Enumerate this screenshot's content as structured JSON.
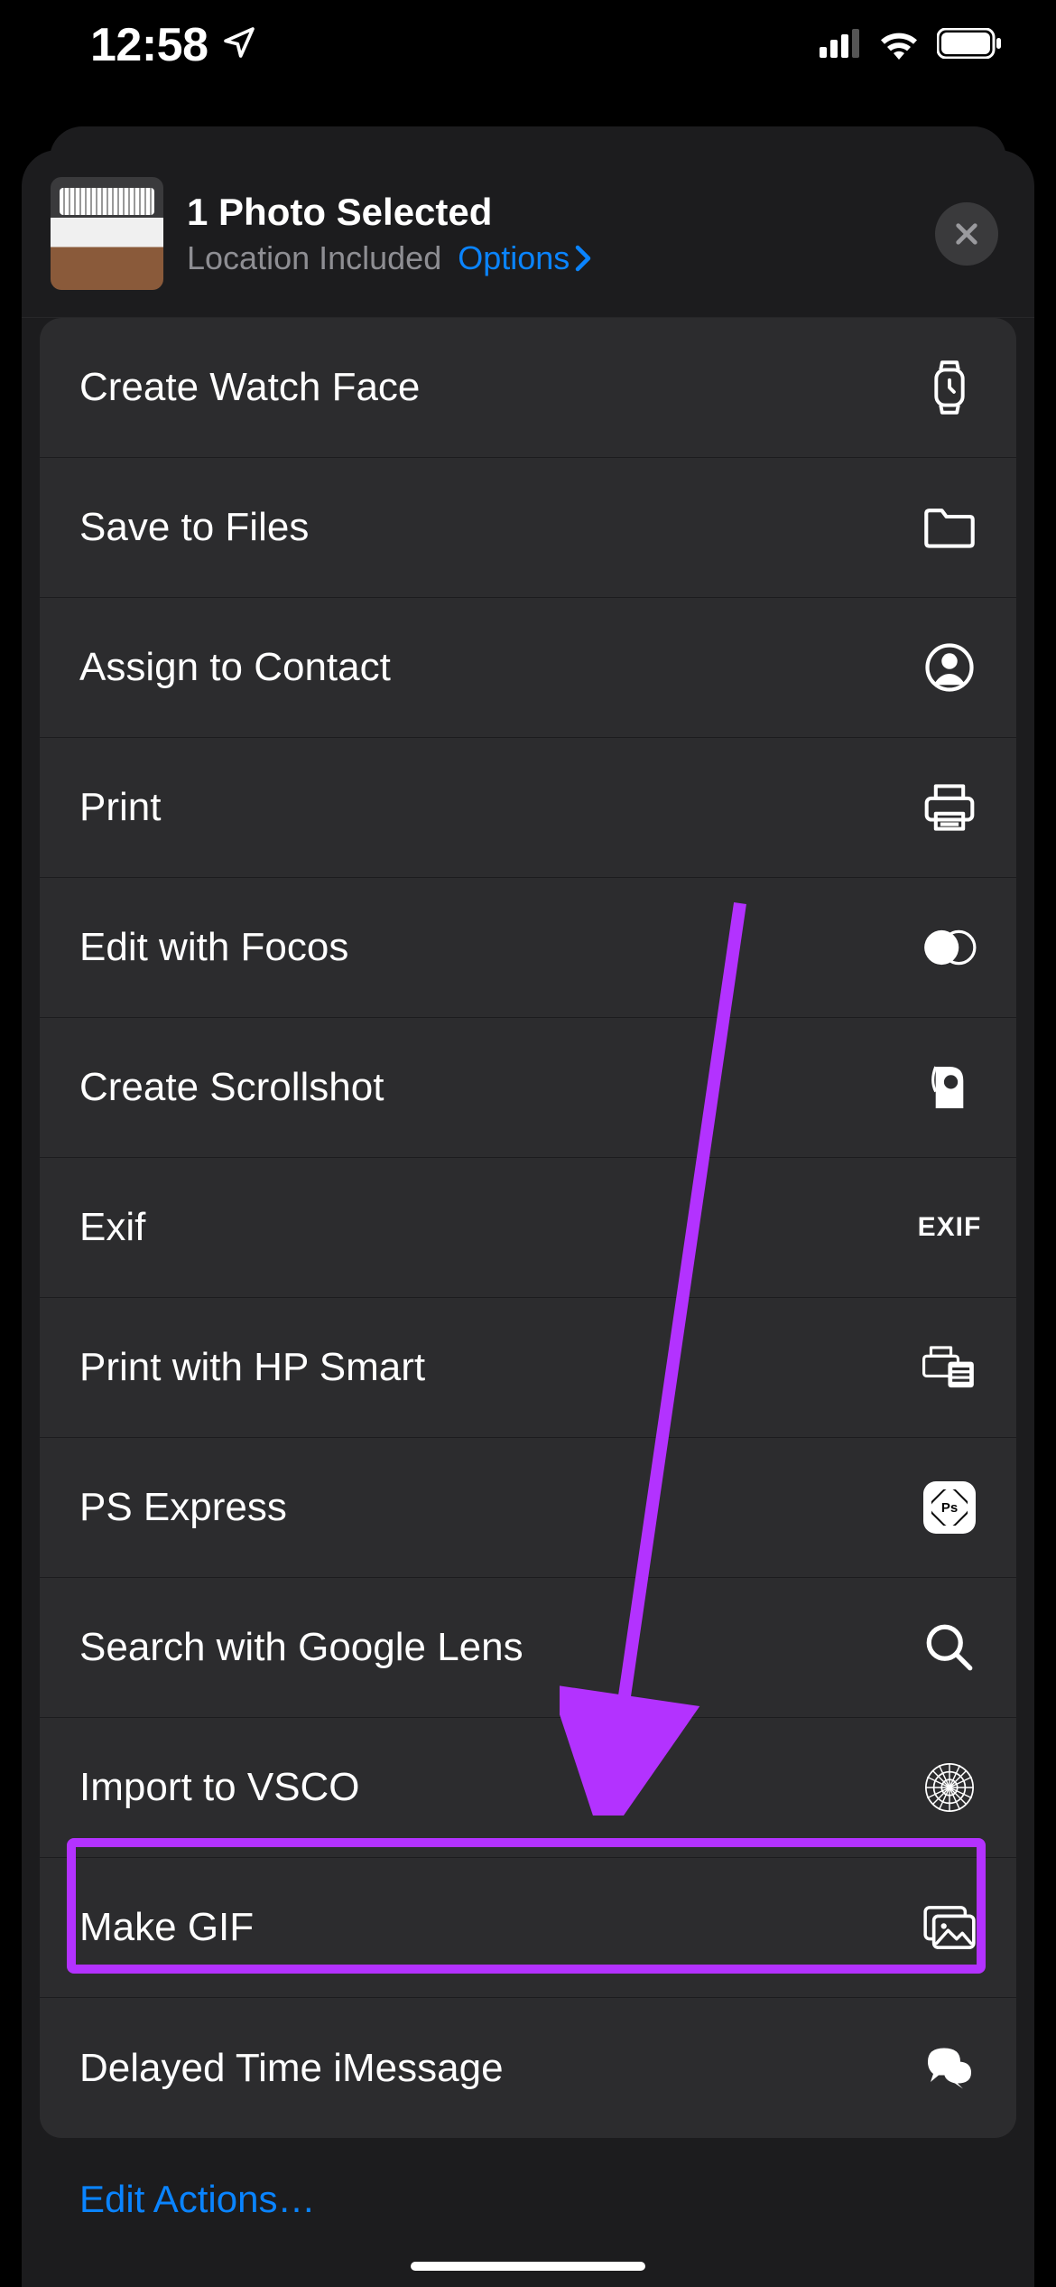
{
  "status": {
    "time": "12:58"
  },
  "header": {
    "title": "1 Photo Selected",
    "subtitle": "Location Included",
    "options_label": "Options"
  },
  "actions": [
    {
      "label": "Create Watch Face",
      "icon": "watch-icon"
    },
    {
      "label": "Save to Files",
      "icon": "folder-icon"
    },
    {
      "label": "Assign to Contact",
      "icon": "contact-icon"
    },
    {
      "label": "Print",
      "icon": "printer-icon"
    },
    {
      "label": "Edit with Focos",
      "icon": "focos-icon"
    },
    {
      "label": "Create Scrollshot",
      "icon": "scrollshot-icon"
    },
    {
      "label": "Exif",
      "icon": "exif-icon"
    },
    {
      "label": "Print with HP Smart",
      "icon": "hp-smart-icon"
    },
    {
      "label": "PS Express",
      "icon": "ps-express-icon"
    },
    {
      "label": "Search with Google Lens",
      "icon": "google-lens-icon"
    },
    {
      "label": "Import to VSCO",
      "icon": "vsco-icon"
    },
    {
      "label": "Make GIF",
      "icon": "make-gif-icon"
    },
    {
      "label": "Delayed Time iMessage",
      "icon": "imessage-icon"
    }
  ],
  "footer": {
    "edit_actions": "Edit Actions…"
  },
  "annotation": {
    "highlight_action_index": 11,
    "colors": {
      "highlight": "#b332ff",
      "link": "#0a84ff"
    }
  }
}
